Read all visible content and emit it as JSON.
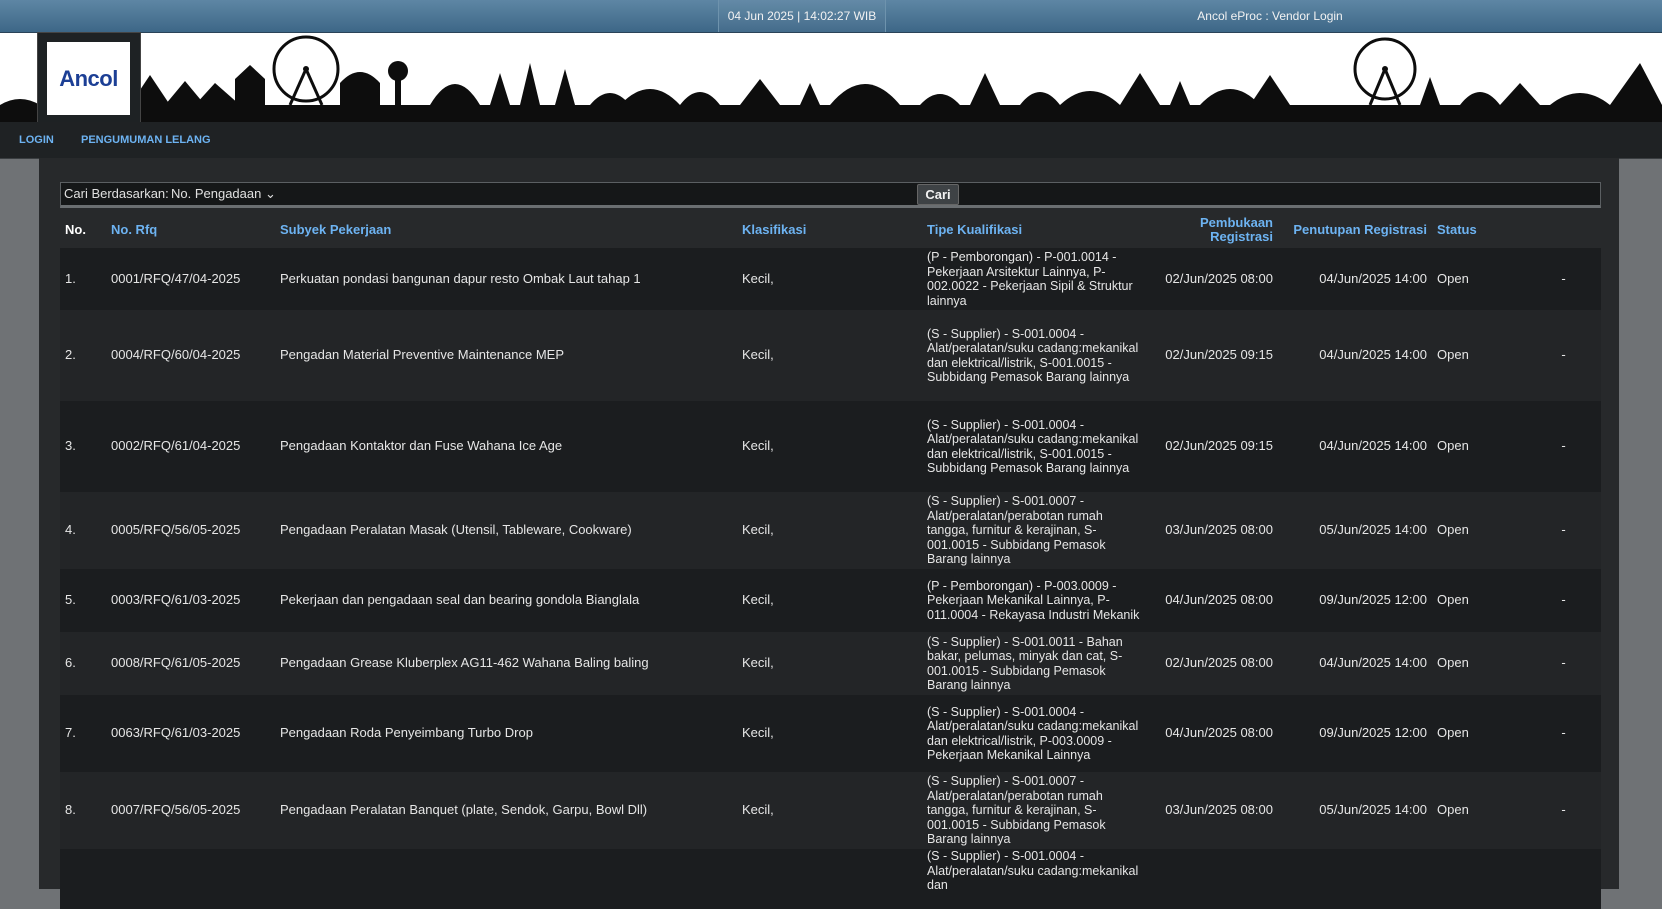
{
  "topbar": {
    "clock": "04 Jun 2025 | 14:02:27 WIB",
    "title": "Ancol eProc : Vendor Login"
  },
  "logo": {
    "text": "Ancol"
  },
  "nav": {
    "items": [
      {
        "label": "LOGIN"
      },
      {
        "label": "PENGUMUMAN LELANG"
      }
    ]
  },
  "search": {
    "label": "Cari Berdasarkan:",
    "selected": "No. Pengadaan",
    "button": "Cari"
  },
  "table": {
    "headers": {
      "no": "No.",
      "rfq": "No. Rfq",
      "subyek": "Subyek Pekerjaan",
      "klasifikasi": "Klasifikasi",
      "tipe": "Tipe Kualifikasi",
      "pembukaan": "Pembukaan Registrasi",
      "penutupan": "Penutupan Registrasi",
      "status": "Status"
    },
    "rows": [
      {
        "no": "1.",
        "rfq": "0001/RFQ/47/04-2025",
        "subyek": "Perkuatan pondasi bangunan dapur resto Ombak Laut tahap 1",
        "klasifikasi": "Kecil,",
        "tipe": "(P - Pemborongan) - P-001.0014 - Pekerjaan Arsitektur Lainnya, P-002.0022 - Pekerjaan Sipil & Struktur lainnya",
        "pembukaan": "02/Jun/2025 08:00",
        "penutupan": "04/Jun/2025 14:00",
        "status": "Open",
        "extra": "-"
      },
      {
        "no": "2.",
        "rfq": "0004/RFQ/60/04-2025",
        "subyek": "Pengadan Material Preventive Maintenance MEP",
        "klasifikasi": "Kecil,",
        "tipe": "(S - Supplier) - S-001.0004 - Alat/peralatan/suku cadang:mekanikal dan elektrical/listrik, S-001.0015 - Subbidang Pemasok Barang lainnya",
        "pembukaan": "02/Jun/2025 09:15",
        "penutupan": "04/Jun/2025 14:00",
        "status": "Open",
        "extra": "-"
      },
      {
        "no": "3.",
        "rfq": "0002/RFQ/61/04-2025",
        "subyek": "Pengadaan Kontaktor dan Fuse Wahana Ice Age",
        "klasifikasi": "Kecil,",
        "tipe": "(S - Supplier) - S-001.0004 - Alat/peralatan/suku cadang:mekanikal dan elektrical/listrik, S-001.0015 - Subbidang Pemasok Barang lainnya",
        "pembukaan": "02/Jun/2025 09:15",
        "penutupan": "04/Jun/2025 14:00",
        "status": "Open",
        "extra": "-"
      },
      {
        "no": "4.",
        "rfq": "0005/RFQ/56/05-2025",
        "subyek": "Pengadaan Peralatan Masak (Utensil, Tableware, Cookware)",
        "klasifikasi": "Kecil,",
        "tipe": "(S - Supplier) - S-001.0007 - Alat/peralatan/perabotan rumah tangga, furnitur & kerajinan, S-001.0015 - Subbidang Pemasok Barang lainnya",
        "pembukaan": "03/Jun/2025 08:00",
        "penutupan": "05/Jun/2025 14:00",
        "status": "Open",
        "extra": "-"
      },
      {
        "no": "5.",
        "rfq": "0003/RFQ/61/03-2025",
        "subyek": "Pekerjaan dan pengadaan seal dan bearing gondola Bianglala",
        "klasifikasi": "Kecil,",
        "tipe": "(P - Pemborongan) - P-003.0009 - Pekerjaan Mekanikal Lainnya, P-011.0004 - Rekayasa Industri Mekanik",
        "pembukaan": "04/Jun/2025 08:00",
        "penutupan": "09/Jun/2025 12:00",
        "status": "Open",
        "extra": "-"
      },
      {
        "no": "6.",
        "rfq": "0008/RFQ/61/05-2025",
        "subyek": "Pengadaan Grease Kluberplex AG11-462 Wahana Baling baling",
        "klasifikasi": "Kecil,",
        "tipe": "(S - Supplier) - S-001.0011 - Bahan bakar, pelumas, minyak dan cat, S-001.0015 - Subbidang Pemasok Barang lainnya",
        "pembukaan": "02/Jun/2025 08:00",
        "penutupan": "04/Jun/2025 14:00",
        "status": "Open",
        "extra": "-"
      },
      {
        "no": "7.",
        "rfq": "0063/RFQ/61/03-2025",
        "subyek": "Pengadaan Roda Penyeimbang Turbo Drop",
        "klasifikasi": "Kecil,",
        "tipe": "(S - Supplier) - S-001.0004 - Alat/peralatan/suku cadang:mekanikal dan elektrical/listrik, P-003.0009 - Pekerjaan Mekanikal Lainnya",
        "pembukaan": "04/Jun/2025 08:00",
        "penutupan": "09/Jun/2025 12:00",
        "status": "Open",
        "extra": "-"
      },
      {
        "no": "8.",
        "rfq": "0007/RFQ/56/05-2025",
        "subyek": "Pengadaan Peralatan Banquet (plate, Sendok, Garpu, Bowl Dll)",
        "klasifikasi": "Kecil,",
        "tipe": "(S - Supplier) - S-001.0007 - Alat/peralatan/perabotan rumah tangga, furnitur & kerajinan, S-001.0015 - Subbidang Pemasok Barang lainnya",
        "pembukaan": "03/Jun/2025 08:00",
        "penutupan": "05/Jun/2025 14:00",
        "status": "Open",
        "extra": "-"
      },
      {
        "no": "",
        "rfq": "",
        "subyek": "",
        "klasifikasi": "",
        "tipe": "(S - Supplier) - S-001.0004 - Alat/peralatan/suku cadang:mekanikal dan",
        "pembukaan": "",
        "penutupan": "",
        "status": "",
        "extra": ""
      }
    ]
  }
}
